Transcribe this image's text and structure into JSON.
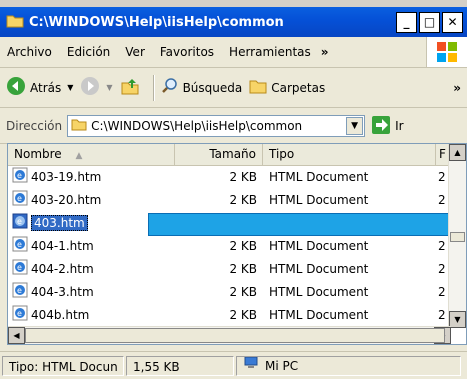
{
  "window": {
    "title": "C:\\WINDOWS\\Help\\iisHelp\\common",
    "minimize": "_",
    "maximize": "□",
    "close": "✕"
  },
  "menubar": {
    "items": [
      "Archivo",
      "Edición",
      "Ver",
      "Favoritos",
      "Herramientas"
    ],
    "overflow": "»"
  },
  "toolbar": {
    "back": "Atrás",
    "search": "Búsqueda",
    "folders": "Carpetas",
    "overflow": "»"
  },
  "address": {
    "label": "Dirección",
    "value": "C:\\WINDOWS\\Help\\iisHelp\\common",
    "go": "Ir"
  },
  "columns": {
    "name": "Nombre",
    "size": "Tamaño",
    "type": "Tipo",
    "date": "F"
  },
  "files": [
    {
      "name": "403-19.htm",
      "size": "2 KB",
      "type": "HTML Document",
      "date": "2"
    },
    {
      "name": "403-20.htm",
      "size": "2 KB",
      "type": "HTML Document",
      "date": "2"
    },
    {
      "name": "403.htm",
      "size": "",
      "type": "",
      "date": "",
      "selected": true
    },
    {
      "name": "404-1.htm",
      "size": "2 KB",
      "type": "HTML Document",
      "date": "2"
    },
    {
      "name": "404-2.htm",
      "size": "2 KB",
      "type": "HTML Document",
      "date": "2"
    },
    {
      "name": "404-3.htm",
      "size": "2 KB",
      "type": "HTML Document",
      "date": "2"
    },
    {
      "name": "404b.htm",
      "size": "2 KB",
      "type": "HTML Document",
      "date": "2"
    }
  ],
  "status": {
    "type": "Tipo: HTML Docun",
    "size": "1,55 KB",
    "location": "Mi PC"
  },
  "colors": {
    "titlebar": "#0550d6",
    "selection": "#1ea3e6"
  }
}
